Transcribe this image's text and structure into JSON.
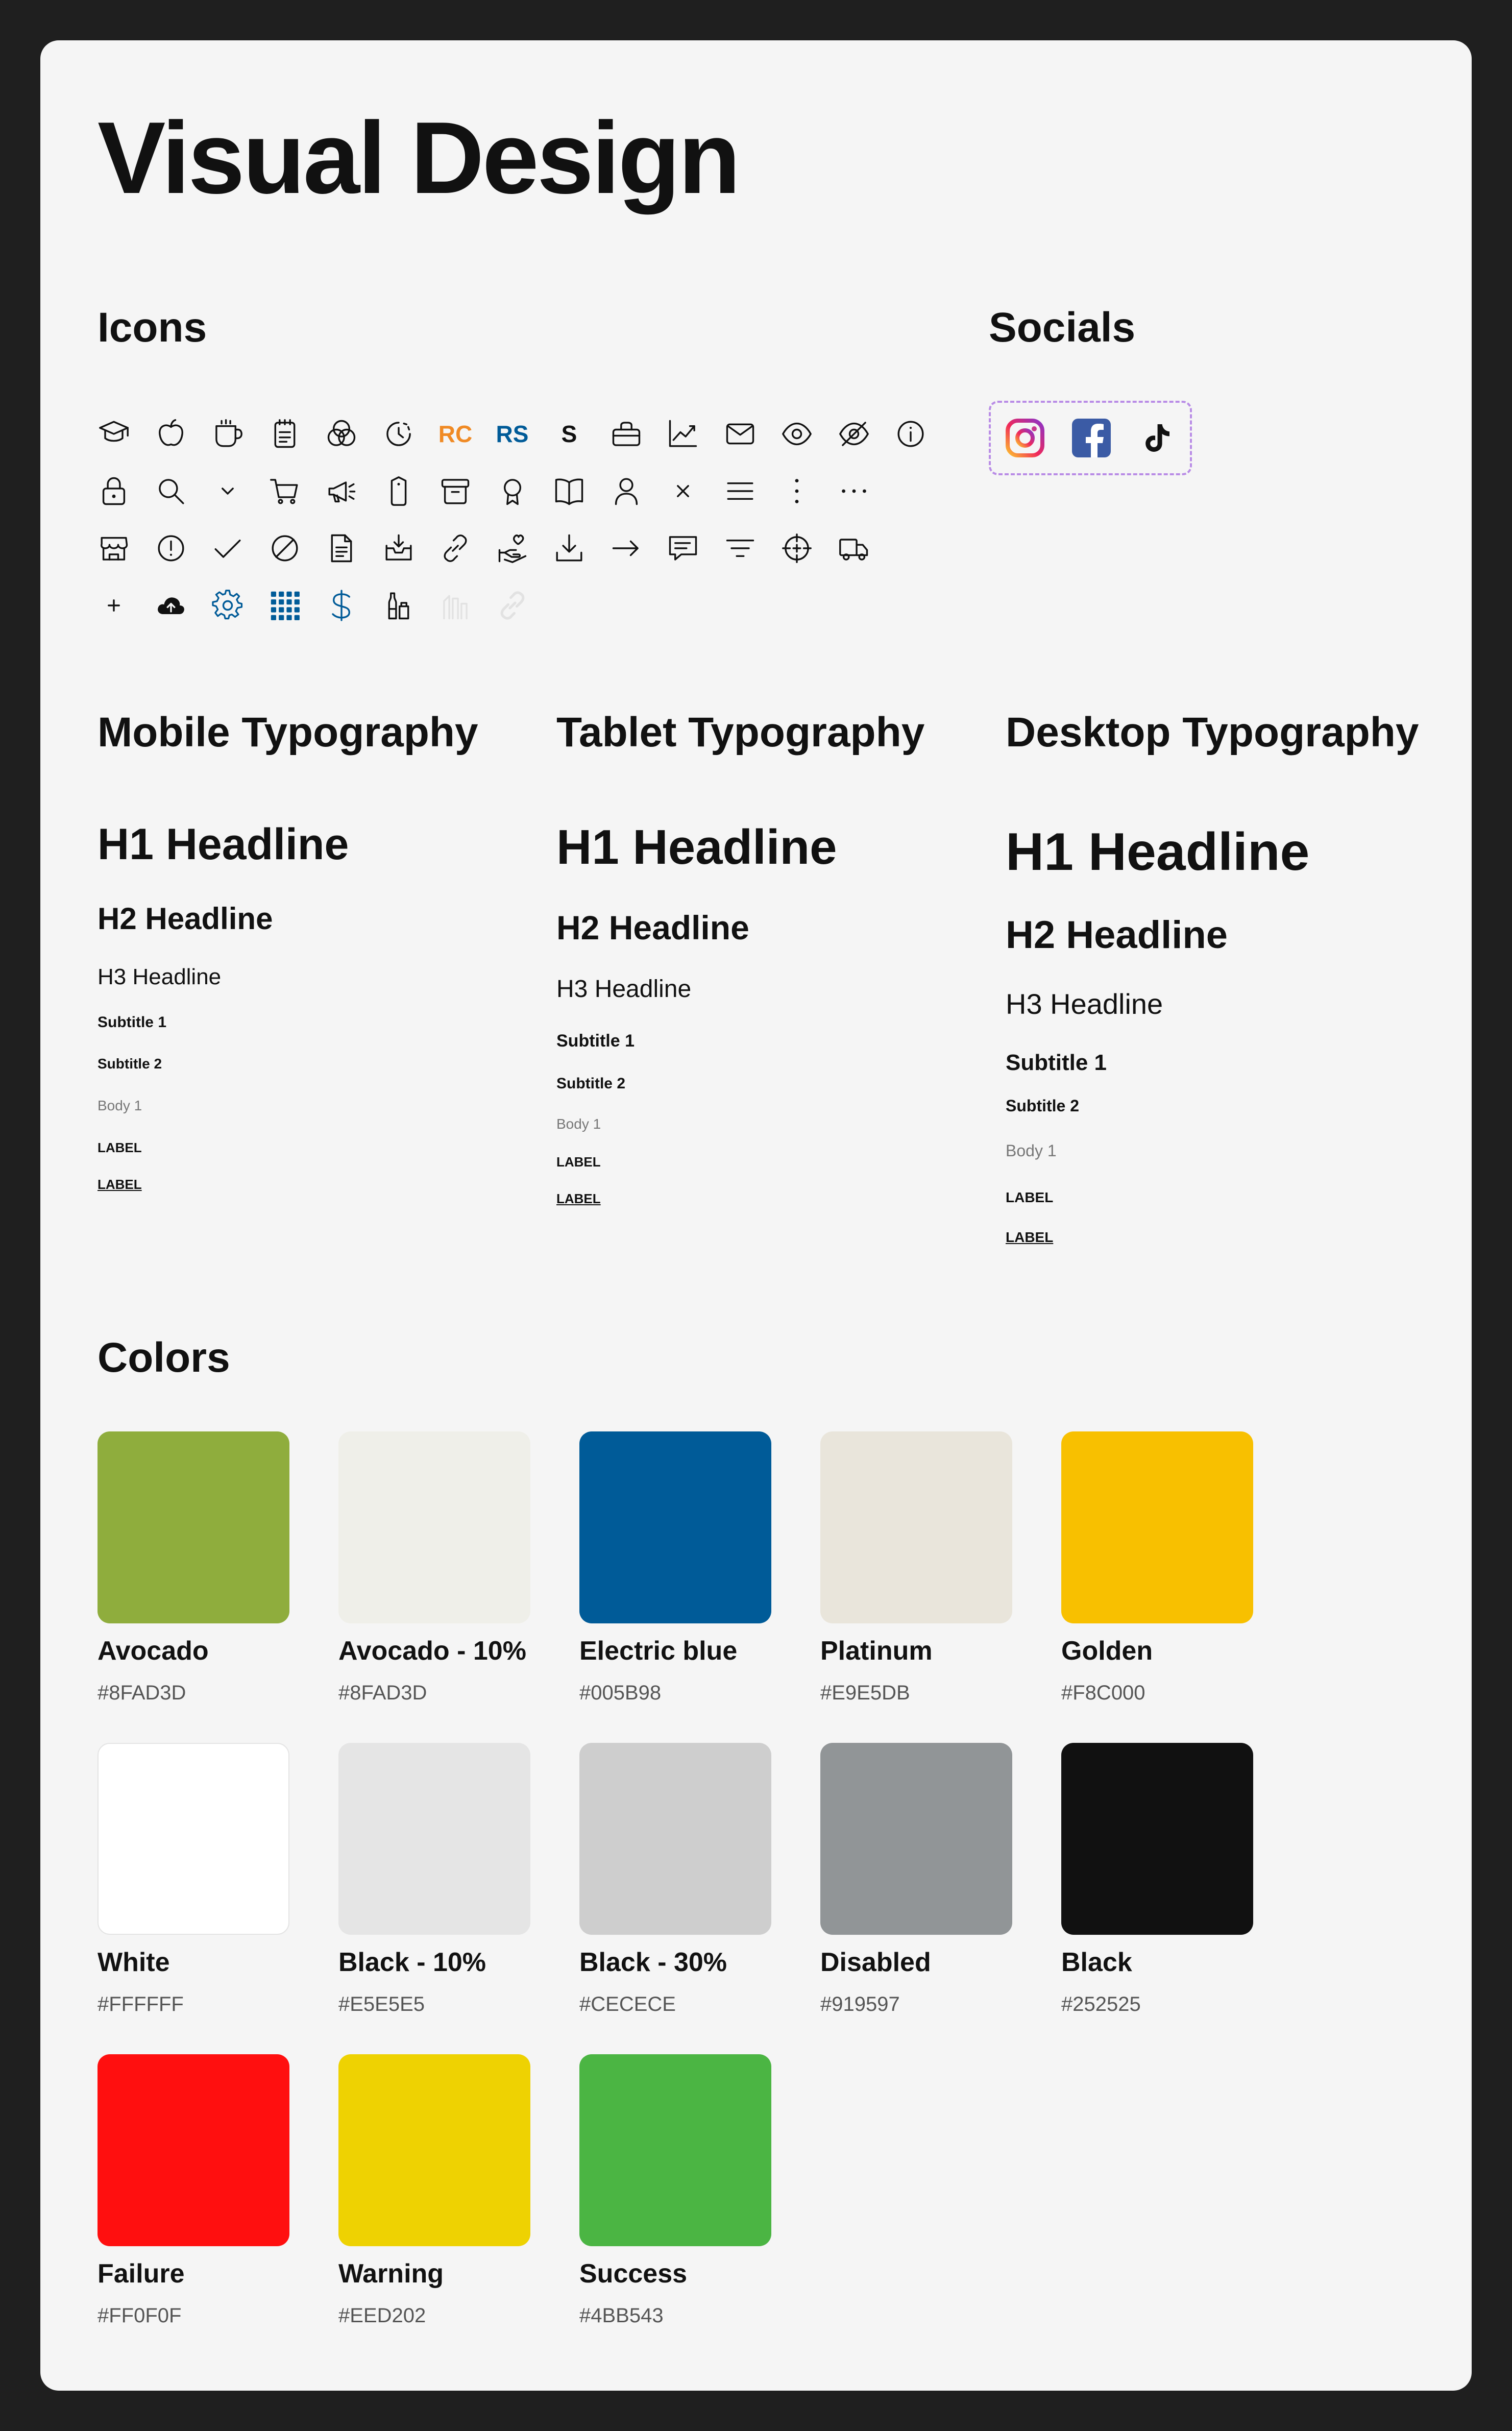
{
  "page": {
    "title": "Visual Design"
  },
  "sections": {
    "icons": "Icons",
    "socials": "Socials",
    "colors": "Colors"
  },
  "icons": [
    "graduation-cap-icon",
    "apple-icon",
    "coffee-cup-icon",
    "notepad-icon",
    "venn-circles-icon",
    "clock-history-icon",
    "rc-text-icon",
    "rs-text-icon",
    "s-text-icon",
    "briefcase-icon",
    "trend-chart-icon",
    "mail-icon",
    "eye-icon",
    "eye-off-icon",
    "info-icon",
    "lock-icon",
    "search-icon",
    "chevron-down-icon",
    "cart-icon",
    "megaphone-icon",
    "tag-icon",
    "archive-icon",
    "award-icon",
    "book-open-icon",
    "user-icon",
    "close-icon",
    "menu-icon",
    "more-vertical-icon",
    "more-horizontal-icon",
    "store-icon",
    "alert-circle-icon",
    "check-icon",
    "ban-icon",
    "document-icon",
    "inbox-download-icon",
    "link-icon",
    "hand-heart-icon",
    "download-icon",
    "arrow-right-icon",
    "message-icon",
    "filter-icon",
    "crosshair-icon",
    "truck-icon",
    "plus-icon",
    "cloud-upload-icon",
    "gear-icon",
    "grid-icon",
    "dollar-icon",
    "bottles-icon",
    "faded-icon",
    "faded-link-icon"
  ],
  "icon_texts": {
    "rc": "RC",
    "rs": "RS",
    "s": "S"
  },
  "socials": [
    "instagram-icon",
    "facebook-icon",
    "tiktok-icon"
  ],
  "typography": [
    {
      "title": "Mobile Typography",
      "h1": "H1 Headline",
      "h2": "H2 Headline",
      "h3": "H3 Headline",
      "sub1": "Subtitle 1",
      "sub2": "Subtitle 2",
      "body": "Body 1",
      "label": "LABEL",
      "label_link": "LABEL"
    },
    {
      "title": "Tablet Typography",
      "h1": "H1 Headline",
      "h2": "H2 Headline",
      "h3": "H3 Headline",
      "sub1": "Subtitle 1",
      "sub2": "Subtitle 2",
      "body": "Body 1",
      "label": "LABEL",
      "label_link": "LABEL"
    },
    {
      "title": "Desktop Typography",
      "h1": "H1 Headline",
      "h2": "H2 Headline",
      "h3": "H3 Headline",
      "sub1": "Subtitle 1",
      "sub2": "Subtitle 2",
      "body": "Body 1",
      "label": "LABEL",
      "label_link": "LABEL"
    }
  ],
  "colors": [
    {
      "name": "Avocado",
      "hex": "#8FAD3D",
      "fill": "#8FAD3D"
    },
    {
      "name": "Avocado - 10%",
      "hex": "#8FAD3D",
      "fill": "#EFEFE9"
    },
    {
      "name": "Electric blue",
      "hex": "#005B98",
      "fill": "#005B98"
    },
    {
      "name": "Platinum",
      "hex": "#E9E5DB",
      "fill": "#E9E5DB"
    },
    {
      "name": "Golden",
      "hex": "#F8C000",
      "fill": "#F8C000"
    },
    {
      "name": "White",
      "hex": "#FFFFFF",
      "fill": "#FFFFFF"
    },
    {
      "name": "Black - 10%",
      "hex": "#E5E5E5",
      "fill": "#E5E5E5"
    },
    {
      "name": "Black - 30%",
      "hex": "#CECECE",
      "fill": "#CECECE"
    },
    {
      "name": "Disabled",
      "hex": "#919597",
      "fill": "#919597"
    },
    {
      "name": "Black",
      "hex": "#252525",
      "fill": "#111111"
    },
    {
      "name": "Failure",
      "hex": "#FF0F0F",
      "fill": "#FF0F0F"
    },
    {
      "name": "Warning",
      "hex": "#EED202",
      "fill": "#EED202"
    },
    {
      "name": "Success",
      "hex": "#4BB543",
      "fill": "#4BB543"
    }
  ],
  "accent": {
    "orange": "#F08A24",
    "blue": "#005B98",
    "purple_border": "#B98CE6"
  }
}
